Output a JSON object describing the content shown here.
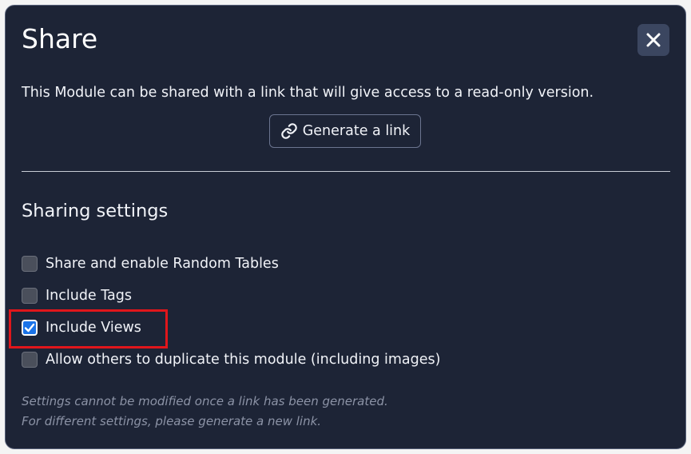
{
  "dialog": {
    "title": "Share",
    "close_icon": "close-icon",
    "description": "This Module can be shared with a link that will give access to a read-only version.",
    "generate_button": {
      "label": "Generate a link",
      "icon": "link-icon"
    }
  },
  "sharing": {
    "heading": "Sharing settings",
    "options": [
      {
        "label": "Share and enable Random Tables",
        "checked": false
      },
      {
        "label": "Include Tags",
        "checked": false
      },
      {
        "label": "Include Views",
        "checked": true
      },
      {
        "label": "Allow others to duplicate this module (including images)",
        "checked": false
      }
    ],
    "notes": [
      "Settings cannot be modified once a link has been generated.",
      "For different settings, please generate a new link."
    ]
  },
  "colors": {
    "background": "#1d2436",
    "close_button_bg": "#3b4660",
    "checkbox_checked": "#1a73e8",
    "highlight": "#e0161b",
    "note_text": "#8c93a6"
  }
}
